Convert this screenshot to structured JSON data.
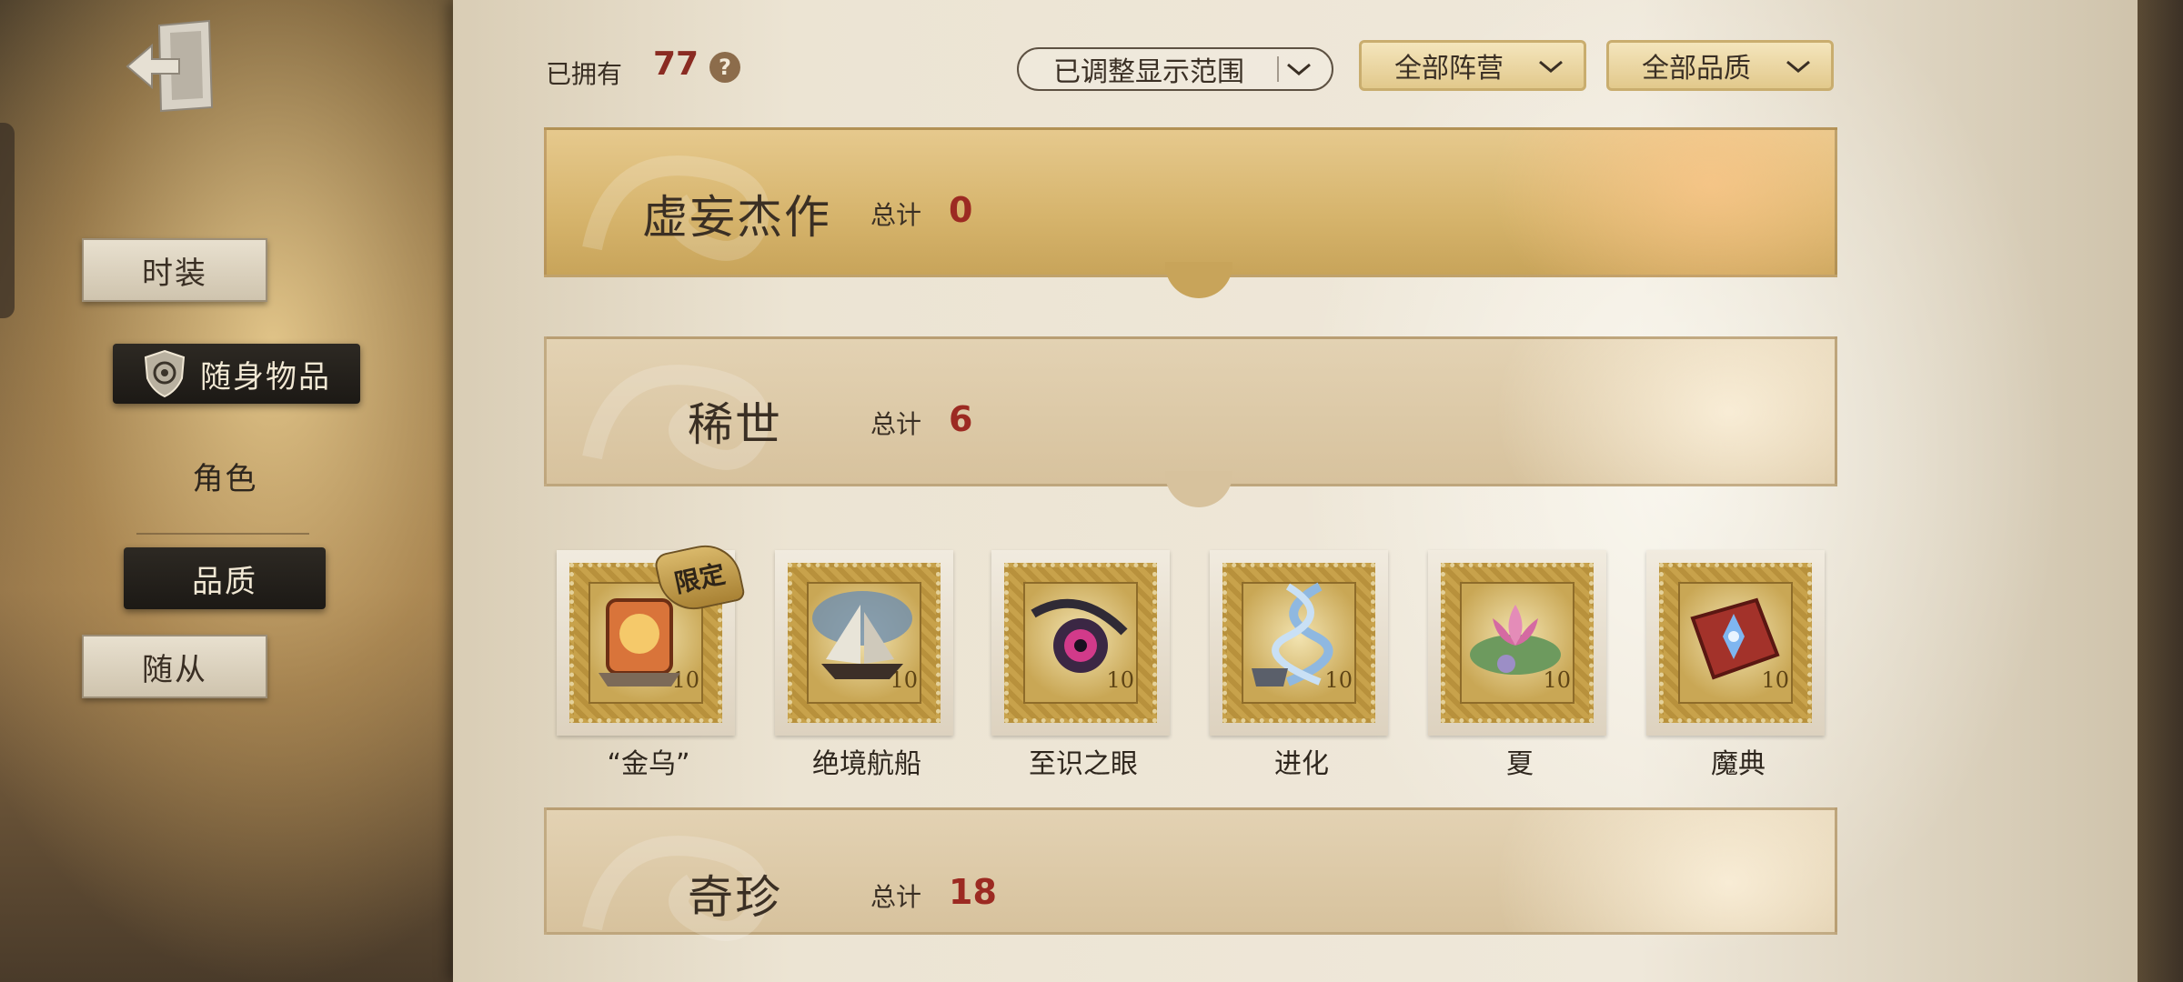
{
  "sidebar": {
    "items": [
      {
        "label": "时装"
      },
      {
        "label": "随身物品"
      },
      {
        "label": "角色"
      },
      {
        "label": "品质"
      },
      {
        "label": "随从"
      }
    ]
  },
  "header": {
    "owned_label": "已拥有",
    "owned_count": "77",
    "help_symbol": "?",
    "filters": [
      {
        "label": "已调整显示范围"
      },
      {
        "label": "全部阵营"
      },
      {
        "label": "全部品质"
      }
    ]
  },
  "categories": [
    {
      "title": "虚妄杰作",
      "total_label": "总计",
      "total": "0"
    },
    {
      "title": "稀世",
      "total_label": "总计",
      "total": "6"
    },
    {
      "title": "奇珍",
      "total_label": "总计",
      "total": "18"
    }
  ],
  "items": [
    {
      "name": "“金乌”",
      "badge": "限定",
      "number": "10",
      "icon": "scroll-lantern-icon"
    },
    {
      "name": "绝境航船",
      "number": "10",
      "icon": "ship-icon"
    },
    {
      "name": "至识之眼",
      "number": "10",
      "icon": "eye-icon"
    },
    {
      "name": "进化",
      "number": "10",
      "icon": "dna-helix-icon"
    },
    {
      "name": "夏",
      "number": "10",
      "icon": "lotus-icon"
    },
    {
      "name": "魔典",
      "number": "10",
      "icon": "spellbook-icon"
    }
  ],
  "colors": {
    "count_red": "#9c2a22",
    "gold": "#d6b46c",
    "paper": "#ece4d3",
    "dark_button": "#1c1915"
  }
}
